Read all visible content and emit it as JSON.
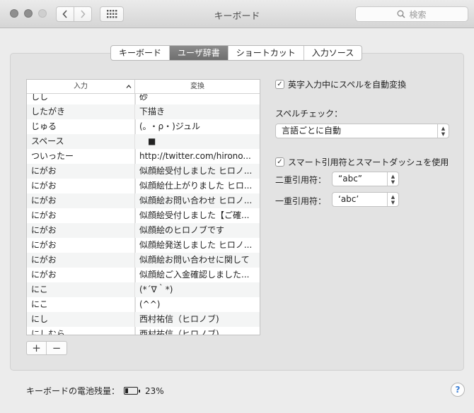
{
  "window": {
    "title": "キーボード"
  },
  "search": {
    "placeholder": "検索"
  },
  "tabs": [
    {
      "label": "キーボード",
      "active": false
    },
    {
      "label": "ユーザ辞書",
      "active": true
    },
    {
      "label": "ショートカット",
      "active": false
    },
    {
      "label": "入力ソース",
      "active": false
    }
  ],
  "table": {
    "headers": {
      "input": "入力",
      "replace": "変換"
    },
    "rows": [
      {
        "input": "しし",
        "replace": "砂"
      },
      {
        "input": "したがき",
        "replace": "下描き"
      },
      {
        "input": "じゅる",
        "replace": "(｡ ・ρ・)ジュル"
      },
      {
        "input": "スペース",
        "replace": "■"
      },
      {
        "input": "ついったー",
        "replace": "http://twitter.com/hirono..."
      },
      {
        "input": "にがお",
        "replace": "似顔絵受付しました ヒロノ..."
      },
      {
        "input": "にがお",
        "replace": "似顔絵仕上がりました ヒロ..."
      },
      {
        "input": "にがお",
        "replace": "似顔絵お問い合わせ ヒロノ..."
      },
      {
        "input": "にがお",
        "replace": "似顔絵受付しました【ご確..."
      },
      {
        "input": "にがお",
        "replace": "似顔絵のヒロノブです"
      },
      {
        "input": "にがお",
        "replace": "似顔絵発送しました ヒロノ..."
      },
      {
        "input": "にがお",
        "replace": "似顔絵お問い合わせに関して"
      },
      {
        "input": "にがお",
        "replace": "似顔絵ご入金確認しました..."
      },
      {
        "input": "にこ",
        "replace": "(*´∇｀*)"
      },
      {
        "input": "にこ",
        "replace": "(^^)"
      },
      {
        "input": "にし",
        "replace": "西村祐信（ヒロノブ)"
      },
      {
        "input": "にしむら",
        "replace": "西村祐信（ヒロノブ)"
      }
    ]
  },
  "buttons": {
    "add": "+",
    "remove": "−"
  },
  "options": {
    "autocorrect_label": "英字入力中にスペルを自動変換",
    "autocorrect_checked": true,
    "spellcheck_label": "スペルチェック：",
    "spellcheck_value": "言語ごとに自動",
    "smart_quotes_label": "スマート引用符とスマートダッシュを使用",
    "smart_quotes_checked": true,
    "double_quote_label": "二重引用符：",
    "double_quote_value": "“abc”",
    "single_quote_label": "一重引用符：",
    "single_quote_value": "‘abc’"
  },
  "battery": {
    "label": "キーボードの電池残量：",
    "percent": "23%",
    "level": 0.23
  },
  "help": {
    "label": "?"
  }
}
